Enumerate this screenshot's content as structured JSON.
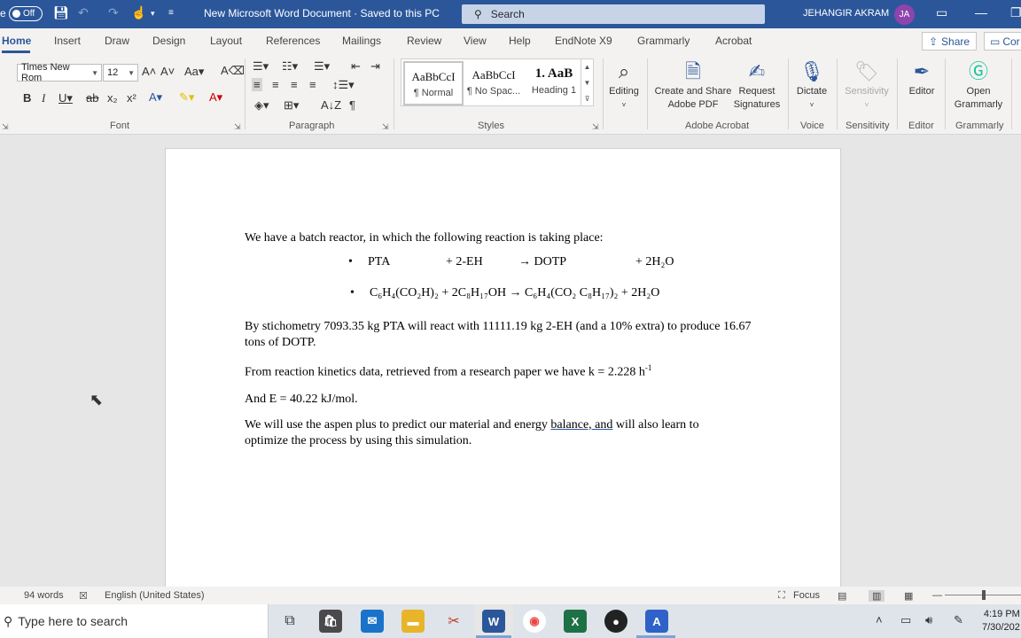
{
  "titlebar": {
    "autosave_cut": "e",
    "autosave_state": "Off",
    "doc_title": "New Microsoft Word Document  ·  Saved to this PC",
    "search_placeholder": "Search",
    "user_name": "JEHANGIR AKRAM",
    "user_initials": "JA",
    "colors": {
      "bar": "#2b579a",
      "avatar": "#8e44ad"
    }
  },
  "tabs": {
    "items": [
      "Home",
      "Insert",
      "Draw",
      "Design",
      "Layout",
      "References",
      "Mailings",
      "Review",
      "View",
      "Help",
      "EndNote X9",
      "Grammarly",
      "Acrobat"
    ],
    "active": "Home",
    "share": "Share",
    "comments": "Cor"
  },
  "ribbon": {
    "font_name": "Times New Rom",
    "font_size": "12",
    "groups": {
      "font": "Font",
      "paragraph": "Paragraph",
      "styles": "Styles",
      "adobe": "Adobe Acrobat",
      "voice": "Voice",
      "sensitivity": "Sensitivity",
      "editor": "Editor",
      "grammarly": "Grammarly"
    },
    "styles": [
      {
        "sample": "AaBbCcI",
        "name": "¶ Normal"
      },
      {
        "sample": "AaBbCcI",
        "name": "¶ No Spac..."
      },
      {
        "sample": "1.  AaB",
        "name": "Heading 1"
      }
    ],
    "buttons": {
      "editing": "Editing",
      "create_share_1": "Create and Share",
      "create_share_2": "Adobe PDF",
      "request_1": "Request",
      "request_2": "Signatures",
      "dictate": "Dictate",
      "sensitivity": "Sensitivity",
      "editor": "Editor",
      "open_grammarly_1": "Open",
      "open_grammarly_2": "Grammarly"
    }
  },
  "document": {
    "intro": "We have a batch reactor, in which the following reaction is taking place:",
    "reaction1": {
      "a": "PTA",
      "b": "+ 2-EH",
      "c": "→ DOTP",
      "d": "+ 2H₂O"
    },
    "reaction2": "C₆H₄(CO₂H)₂ + 2C₈H₁₇OH → C₆H₄(CO₂ C₈H₁₇)₂ + 2H₂O",
    "stoich": "By stichometry 7093.35 kg PTA will react with 11111.19 kg 2-EH (and a 10% extra) to produce 16.67 tons of DOTP.",
    "kinetics": "From reaction kinetics data, retrieved from a research paper we have k = 2.228 h",
    "kinetics_sup": "-1",
    "energy": "And E = 40.22 kJ/mol.",
    "aspen_a": "We will use the aspen plus to predict our material and energy ",
    "aspen_b": "balance, and",
    "aspen_c": " will also learn to optimize the process by using this simulation."
  },
  "statusbar": {
    "words": "94 words",
    "language": "English (United States)",
    "focus": "Focus"
  },
  "taskbar": {
    "search_placeholder": "Type here to search",
    "time": "4:19 PM",
    "date": "7/30/202"
  }
}
